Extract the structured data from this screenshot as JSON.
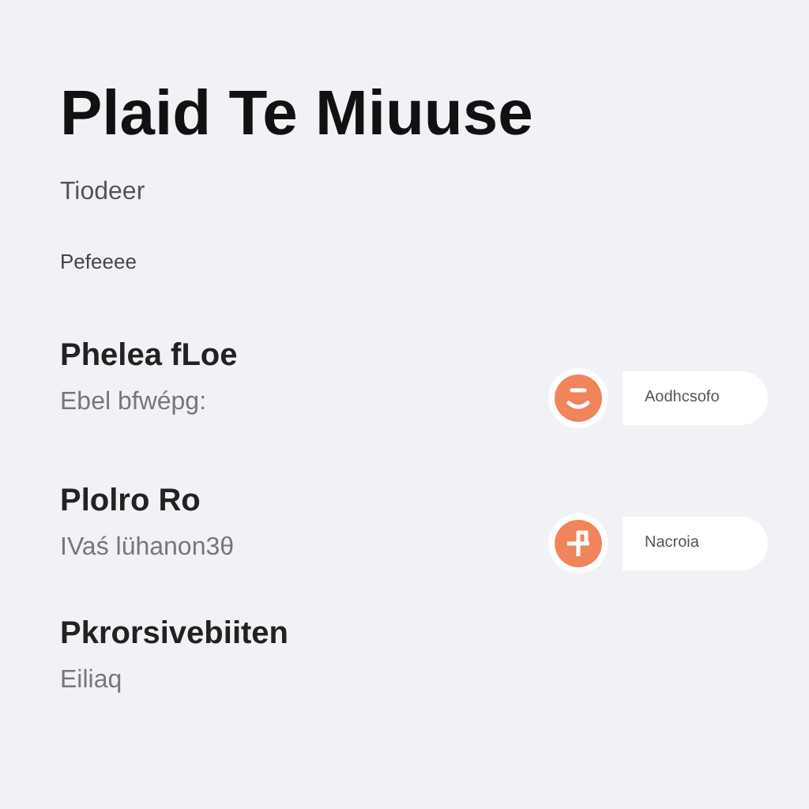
{
  "title": "Plaid Te Miuuse",
  "subtitle": "Tiodeer",
  "caption": "Pefeeee",
  "sections": [
    {
      "heading": "Phelea fLoe",
      "detail": "Ebel bfwépg:",
      "action": {
        "label": "Aodhcsofo"
      }
    },
    {
      "heading": "Plolro Ro",
      "detail": "IVaś lühanon3θ",
      "action": {
        "label": "Nacroia"
      }
    },
    {
      "heading": "Pkrorsivebiiten",
      "detail": "Eiliaq"
    }
  ]
}
